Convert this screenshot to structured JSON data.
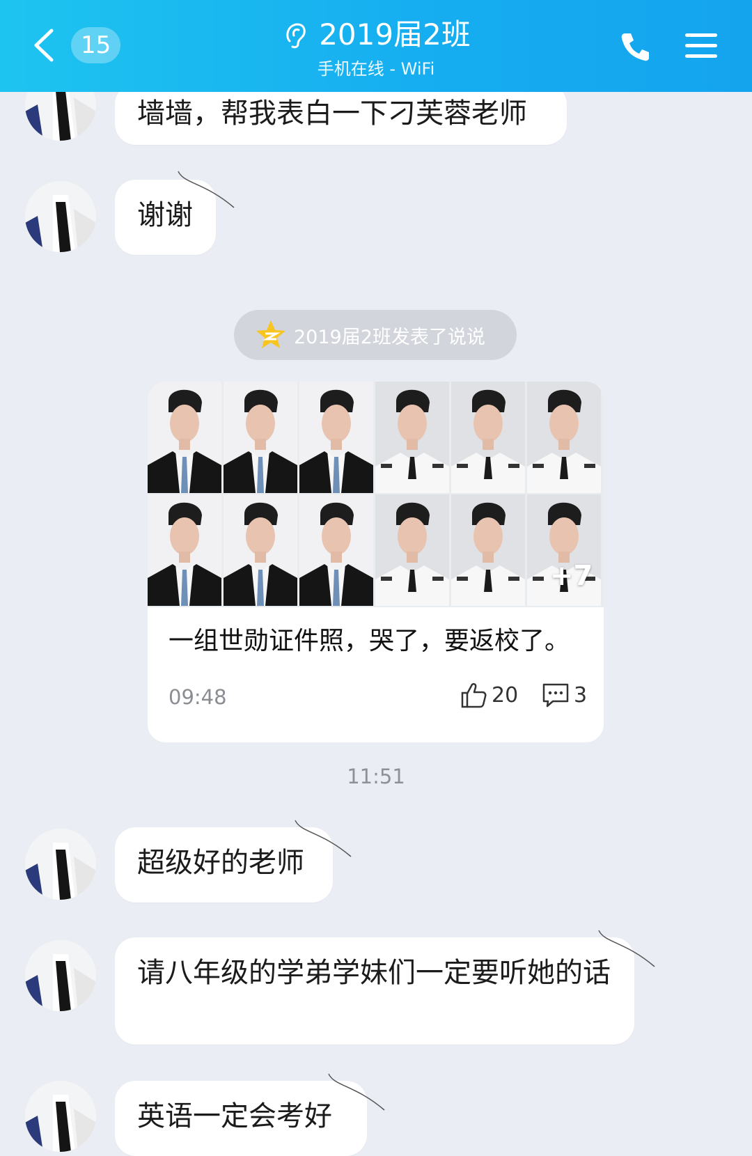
{
  "header": {
    "unread_count": "15",
    "title": "2019届2班",
    "subtitle": "手机在线 - WiFi"
  },
  "messages": [
    {
      "text": "墙墙，帮我表白一下刁芙蓉老师"
    },
    {
      "text": "谢谢"
    },
    {
      "text": "超级好的老师"
    },
    {
      "text": "请八年级的学弟学妹们一定要听她的话"
    },
    {
      "text": "英语一定会考好"
    }
  ],
  "notice": {
    "text": "2019届2班发表了说说"
  },
  "post": {
    "extra_photos": "+7",
    "caption": "一组世勋证件照，哭了，要返校了。",
    "time": "09:48",
    "likes": "20",
    "comments": "3"
  },
  "time_separator": "11:51",
  "colors": {
    "header_start": "#1ec4f0",
    "header_end": "#14a4ee",
    "background": "#eaedf3",
    "bubble": "#ffffff",
    "notice_pill": "#d2d5db"
  },
  "icons": [
    "back-chevron-icon",
    "ear-icon",
    "phone-icon",
    "menu-icon",
    "qzone-star-icon",
    "thumbs-up-icon",
    "comment-icon"
  ]
}
